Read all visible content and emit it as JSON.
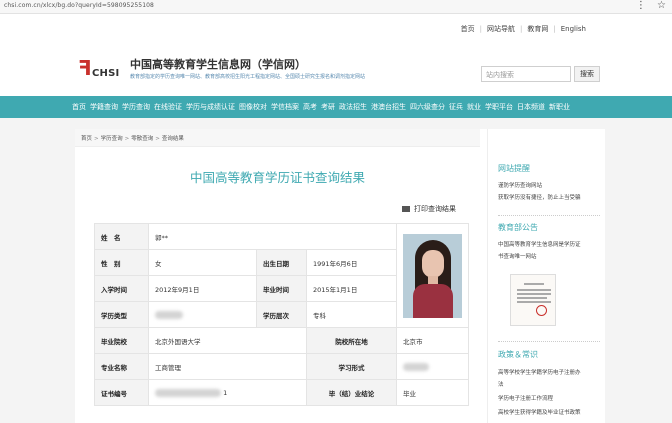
{
  "browser": {
    "url": "chsi.com.cn/xlcx/bg.do?queryId=598095255108",
    "icons": [
      "dots-icon",
      "star-icon"
    ]
  },
  "topnav": {
    "items": [
      "首页",
      "网站导航",
      "教育网"
    ],
    "english": "English"
  },
  "header": {
    "logo_text": "CHSI",
    "title": "中国高等教育学生信息网（学信网）",
    "desc": "教育部指定的学历查询唯一网站、教育部高校招生阳光工程指定网站、全国硕士研究生报名和调剂指定网站",
    "search_placeholder": "站内搜索",
    "search_button": "搜索"
  },
  "nav": [
    "首页",
    "学籍查询",
    "学历查询",
    "在线验证",
    "学历与成绩认证",
    "图像校对",
    "学信档案",
    "高考",
    "考研",
    "政法招生",
    "港澳台招生",
    "四六级查分",
    "征兵",
    "就业",
    "学职平台",
    "日本频道",
    "新职业"
  ],
  "breadcrumb": [
    "首页",
    "学历查询",
    "零散查询",
    "查询结果"
  ],
  "main": {
    "title": "中国高等教育学历证书查询结果",
    "print_label": "打印查询结果",
    "rows": {
      "name_label": "姓　名",
      "name_value": "郭**",
      "gender_label": "性　别",
      "gender_value": "女",
      "birth_label": "出生日期",
      "birth_value": "1991年6月6日",
      "entry_label": "入学时间",
      "entry_value": "2012年9月1日",
      "grad_label": "毕业时间",
      "grad_value": "2015年1月1日",
      "type_label": "学历类型",
      "level_label": "学历层次",
      "level_value": "专科",
      "school_label": "毕业院校",
      "school_value": "北京外国语大学",
      "location_label": "院校所在地",
      "location_value": "北京市",
      "major_label": "专业名称",
      "major_value": "工商管理",
      "form_label": "学习形式",
      "cert_label": "证书编号",
      "cert_value_suffix": "1",
      "result_label": "毕（结）业结论",
      "result_value": "毕业"
    }
  },
  "sidebar": {
    "tips_title": "网站提醒",
    "tips": [
      "谨防学历查询网站",
      "获取学历没有捷径，防止上当受骗"
    ],
    "notice_title": "教育部公告",
    "notices": [
      "中国高等教育学生信息网是学历证",
      "书查询唯一网站"
    ],
    "policy_title": "政策＆常识",
    "policies": [
      "高等学校学生学籍学历电子注册办",
      "法",
      "学历电子注册工作流程",
      "高校学生获得学籍及毕业证书政策"
    ]
  }
}
